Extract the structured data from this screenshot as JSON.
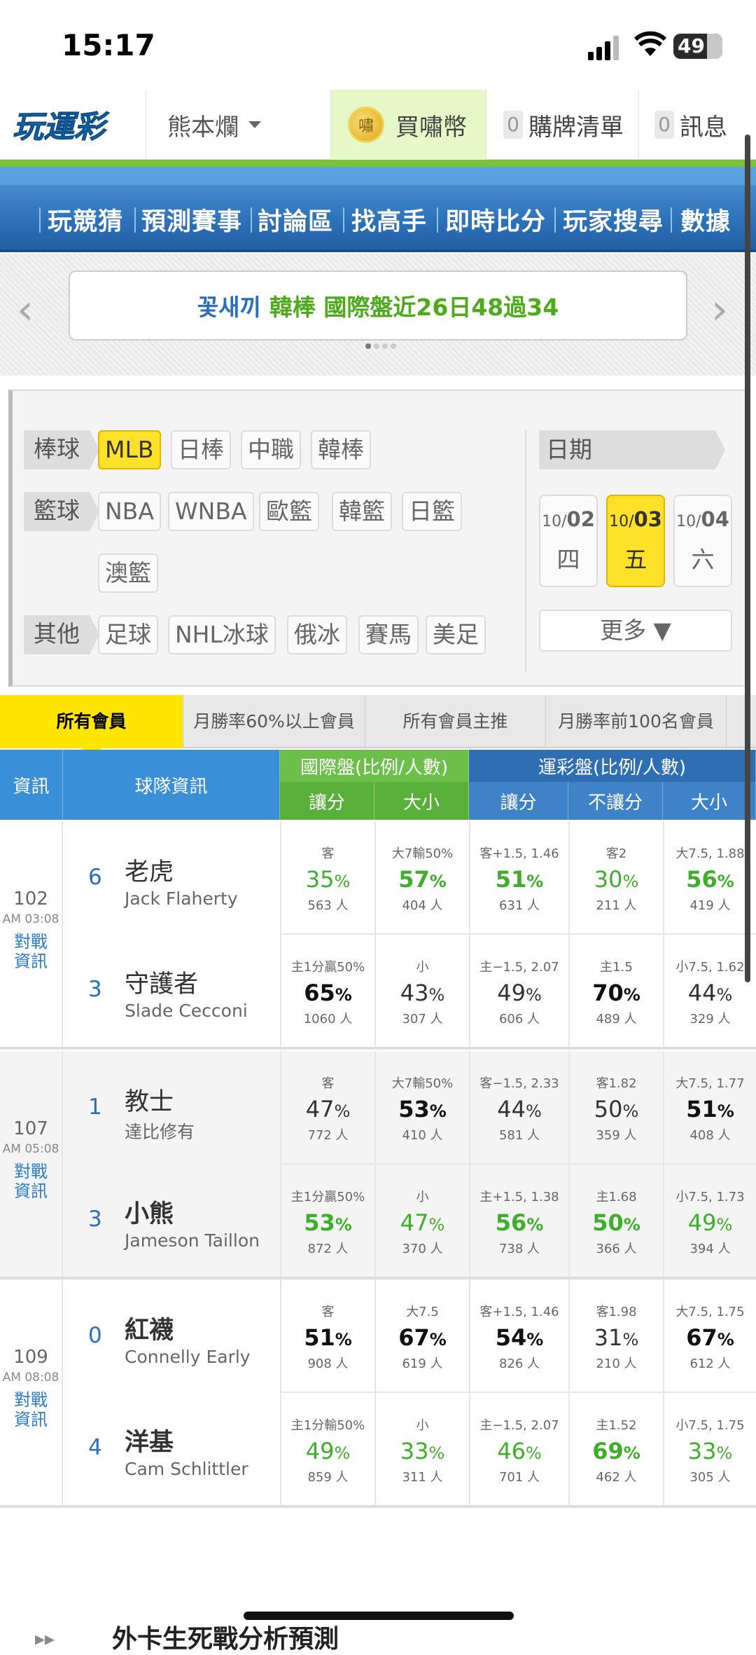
{
  "status": {
    "time": "15:17",
    "battery": "49"
  },
  "topnav": {
    "user": "熊本爛",
    "coin_label": "買嘯幣",
    "coin_icon": "嘯",
    "cart_count": "0",
    "cart_label": "購牌清單",
    "msg_count": "0",
    "msg_label": "訊息",
    "logo_text": "玩運彩"
  },
  "mainnav": [
    "玩競猜",
    "預測賽事",
    "討論區",
    "找高手",
    "即時比分",
    "玩家搜尋",
    "數據"
  ],
  "banner": {
    "player": "꽃새끼",
    "text": "韓棒 國際盤近26日48過34"
  },
  "filter": {
    "baseball": {
      "label": "棒球",
      "chips": [
        "MLB",
        "日棒",
        "中職",
        "韓棒"
      ]
    },
    "basketball": {
      "label": "籃球",
      "chips": [
        "NBA",
        "WNBA",
        "歐籃",
        "韓籃",
        "日籃",
        "澳籃"
      ]
    },
    "other": {
      "label": "其他",
      "chips": [
        "足球",
        "NHL冰球",
        "俄冰",
        "賽馬",
        "美足"
      ]
    },
    "date_label": "日期",
    "days": [
      {
        "m": "10/",
        "d": "02",
        "w": "四"
      },
      {
        "m": "10/",
        "d": "03",
        "w": "五"
      },
      {
        "m": "10/",
        "d": "04",
        "w": "六"
      }
    ],
    "more": "更多 ▼"
  },
  "tabs": [
    "所有會員",
    "月勝率60%以上會員",
    "所有會員主推",
    "月勝率前100名會員"
  ],
  "thead": {
    "info": "資訊",
    "team": "球隊資訊",
    "intl": "國際盤(比例/人數)",
    "sport": "運彩盤(比例/人數)",
    "h1": "讓分",
    "h2": "大小",
    "h3": "讓分",
    "h4": "不讓分",
    "h5": "大小"
  },
  "games": [
    {
      "num": "102",
      "time": "AM 03:08",
      "link1": "對戰",
      "link2": "資訊",
      "away": {
        "score": "6",
        "name": "老虎",
        "pitcher": "Jack Flaherty"
      },
      "home": {
        "score": "3",
        "name": "守護者",
        "pitcher": "Slade Cecconi"
      },
      "rows": [
        [
          {
            "l": "客",
            "p": "35",
            "c": "563 人"
          },
          {
            "l": "大7輸50%",
            "p": "57",
            "c": "404 人"
          },
          {
            "l": "客+1.5, 1.46",
            "p": "51",
            "c": "631 人"
          },
          {
            "l": "客2",
            "p": "30",
            "c": "211 人"
          },
          {
            "l": "大7.5, 1.88",
            "p": "56",
            "c": "419 人"
          }
        ],
        [
          {
            "l": "主1分贏50%",
            "p": "65",
            "c": "1060 人"
          },
          {
            "l": "小",
            "p": "43",
            "c": "307 人"
          },
          {
            "l": "主−1.5, 2.07",
            "p": "49",
            "c": "606 人"
          },
          {
            "l": "主1.5",
            "p": "70",
            "c": "489 人"
          },
          {
            "l": "小7.5, 1.62",
            "p": "44",
            "c": "329 人"
          }
        ]
      ]
    },
    {
      "num": "107",
      "time": "AM 05:08",
      "link1": "對戰",
      "link2": "資訊",
      "away": {
        "score": "1",
        "name": "教士",
        "pitcher": "達比修有"
      },
      "home": {
        "score": "3",
        "name": "小熊",
        "pitcher": "Jameson Taillon"
      },
      "rows": [
        [
          {
            "l": "客",
            "p": "47",
            "c": "772 人"
          },
          {
            "l": "大7輸50%",
            "p": "53",
            "c": "410 人"
          },
          {
            "l": "客−1.5, 2.33",
            "p": "44",
            "c": "581 人"
          },
          {
            "l": "客1.82",
            "p": "50",
            "c": "359 人"
          },
          {
            "l": "大7.5, 1.77",
            "p": "51",
            "c": "408 人"
          }
        ],
        [
          {
            "l": "主1分贏50%",
            "p": "53",
            "c": "872 人"
          },
          {
            "l": "小",
            "p": "47",
            "c": "370 人"
          },
          {
            "l": "主+1.5, 1.38",
            "p": "56",
            "c": "738 人"
          },
          {
            "l": "主1.68",
            "p": "50",
            "c": "366 人"
          },
          {
            "l": "小7.5, 1.73",
            "p": "49",
            "c": "394 人"
          }
        ]
      ]
    },
    {
      "num": "109",
      "time": "AM 08:08",
      "link1": "對戰",
      "link2": "資訊",
      "away": {
        "score": "0",
        "name": "紅襪",
        "pitcher": "Connelly Early"
      },
      "home": {
        "score": "4",
        "name": "洋基",
        "pitcher": "Cam Schlittler"
      },
      "rows": [
        [
          {
            "l": "客",
            "p": "51",
            "c": "908 人"
          },
          {
            "l": "大7.5",
            "p": "67",
            "c": "619 人"
          },
          {
            "l": "客+1.5, 1.46",
            "p": "54",
            "c": "826 人"
          },
          {
            "l": "客1.98",
            "p": "31",
            "c": "210 人"
          },
          {
            "l": "大7.5, 1.75",
            "p": "67",
            "c": "612 人"
          }
        ],
        [
          {
            "l": "主1分輸50%",
            "p": "49",
            "c": "859 人"
          },
          {
            "l": "小",
            "p": "33",
            "c": "311 人"
          },
          {
            "l": "主−1.5, 2.07",
            "p": "46",
            "c": "701 人"
          },
          {
            "l": "主1.52",
            "p": "69",
            "c": "462 人"
          },
          {
            "l": "小7.5, 1.75",
            "p": "33",
            "c": "305 人"
          }
        ]
      ]
    }
  ],
  "footer": {
    "title": "外卡生死戰分析預測"
  }
}
